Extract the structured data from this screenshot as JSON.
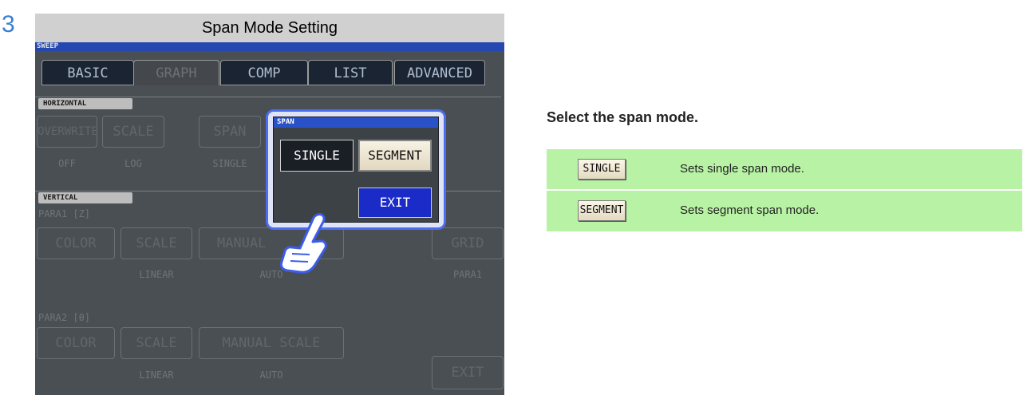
{
  "step_number": "3",
  "header_title": "Span Mode Setting",
  "screen": {
    "mode_label": "SWEEP",
    "tabs": [
      {
        "label": "BASIC",
        "active": false
      },
      {
        "label": "GRAPH",
        "active": true
      },
      {
        "label": "COMP",
        "active": false
      },
      {
        "label": "LIST",
        "active": false
      },
      {
        "label": "ADVANCED",
        "active": false
      }
    ],
    "horizontal": {
      "section_label": "HORIZONTAL",
      "buttons": [
        {
          "label": "OVERWRITE",
          "value": "OFF"
        },
        {
          "label": "SCALE",
          "value": "LOG"
        },
        {
          "label": "SPAN",
          "value": "SINGLE"
        }
      ]
    },
    "vertical": {
      "section_label": "VERTICAL",
      "para1": {
        "label": "PARA1 [Z]",
        "buttons": [
          {
            "label": "COLOR",
            "value": ""
          },
          {
            "label": "SCALE",
            "value": "LINEAR"
          },
          {
            "label": "MANUAL",
            "value": "AUTO"
          }
        ],
        "grid_label": "GRID",
        "grid_value": "PARA1"
      },
      "para2": {
        "label": "PARA2 [θ]",
        "buttons": [
          {
            "label": "COLOR",
            "value": ""
          },
          {
            "label": "SCALE",
            "value": "LINEAR"
          },
          {
            "label": "MANUAL SCALE",
            "value": "AUTO"
          }
        ]
      }
    },
    "exit_label": "EXIT"
  },
  "popup": {
    "title": "SPAN",
    "single_label": "SINGLE",
    "segment_label": "SEGMENT",
    "exit_label": "EXIT"
  },
  "instruction": "Select the span mode.",
  "options_table": [
    {
      "key": "SINGLE",
      "description": "Sets single span mode."
    },
    {
      "key": "SEGMENT",
      "description": "Sets segment span mode."
    }
  ],
  "colors": {
    "step_number": "#3a7fd0",
    "title_bar": "#2a52c8",
    "screen_bg": "#555a5f",
    "popup_border": "#4d6df0",
    "exit_button": "#1b2bc8",
    "table_bg": "#b8f2a4"
  }
}
